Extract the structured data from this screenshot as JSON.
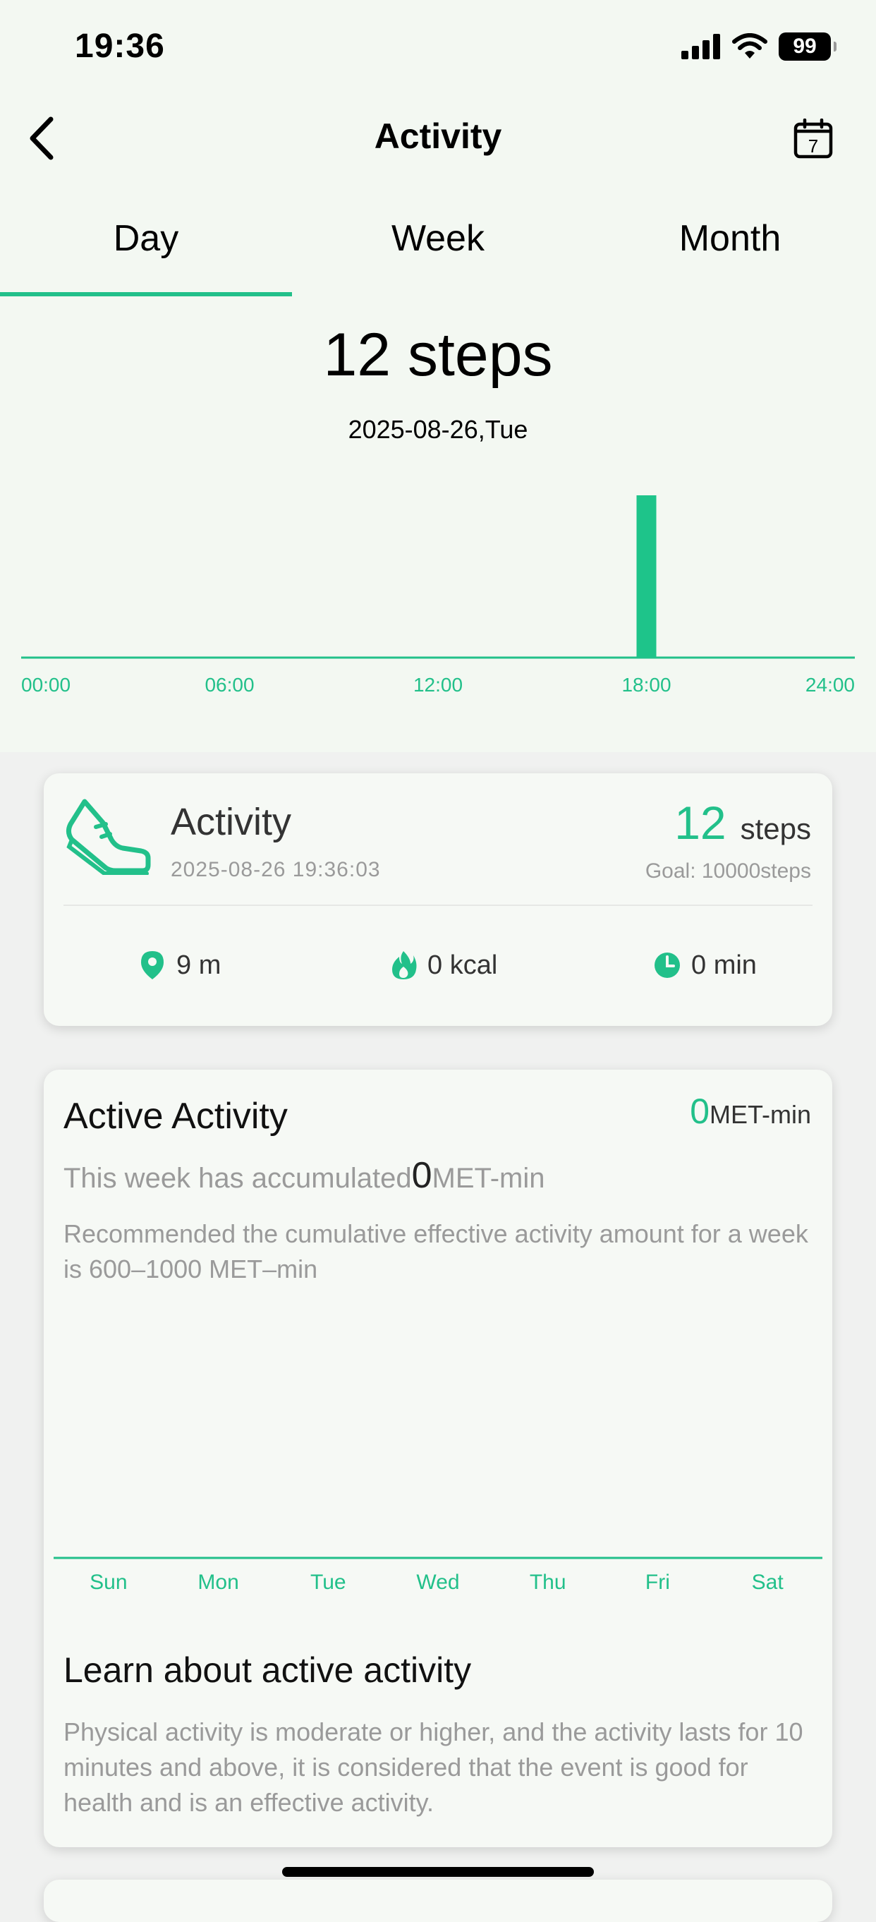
{
  "status_bar": {
    "time": "19:36",
    "battery": "99",
    "icons": [
      "signal-icon",
      "wifi-icon",
      "battery-icon"
    ]
  },
  "nav": {
    "title": "Activity",
    "back_icon": "chevron-left-icon",
    "calendar_icon": "calendar-icon",
    "calendar_day": "7"
  },
  "tabs": [
    {
      "label": "Day",
      "active": true
    },
    {
      "label": "Week",
      "active": false
    },
    {
      "label": "Month",
      "active": false
    }
  ],
  "summary": {
    "steps_text": "12 steps",
    "date_text": "2025-08-26,Tue"
  },
  "chart_data": [
    {
      "type": "bar",
      "x_ticks": [
        "00:00",
        "06:00",
        "12:00",
        "18:00",
        "24:00"
      ],
      "bars": [
        {
          "x": "18:00",
          "value": 12
        }
      ],
      "xlabel": "",
      "ylabel": "",
      "grid": false,
      "color": "#1ec48a"
    },
    {
      "type": "bar",
      "categories": [
        "Sun",
        "Mon",
        "Tue",
        "Wed",
        "Thu",
        "Fri",
        "Sat"
      ],
      "values": [
        0,
        0,
        0,
        0,
        0,
        0,
        0
      ],
      "xlabel": "",
      "ylabel": "",
      "grid": false,
      "color": "#1ec48a"
    }
  ],
  "activity_card": {
    "title": "Activity",
    "timestamp": "2025-08-26 19:36:03",
    "steps_value": "12",
    "steps_unit": "steps",
    "goal": "Goal: 10000steps",
    "metrics": [
      {
        "icon": "location-pin-icon",
        "text": "9 m"
      },
      {
        "icon": "flame-icon",
        "text": "0 kcal"
      },
      {
        "icon": "clock-icon",
        "text": "0 min"
      }
    ]
  },
  "met_card": {
    "title": "Active Activity",
    "value": "0",
    "unit": "MET-min",
    "week_prefix": "This week has accumulated",
    "week_value": "0",
    "week_unit": "MET-min",
    "recommendation": "Recommended the cumulative effective activity amount for a week is 600–1000 MET–min",
    "learn_title": "Learn about active activity",
    "learn_body": "Physical activity is moderate or higher, and the activity lasts for 10 minutes and above, it is considered that the event is good for health and is an effective activity."
  },
  "colors": {
    "accent": "#22c08a",
    "background": "#f3f8f2",
    "card": "#f6f9f5",
    "muted_text": "#9a9a9a"
  }
}
